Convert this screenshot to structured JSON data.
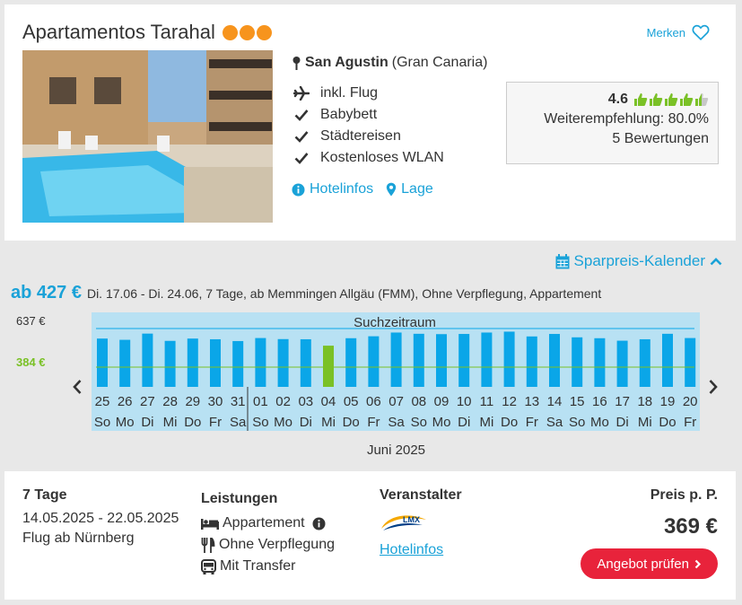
{
  "hotel": {
    "name": "Apartamentos Tarahal",
    "stars": 3,
    "star_color": "#f7941d",
    "merken_label": "Merken",
    "location_city": "San Agustin",
    "location_region": "(Gran Canaria)",
    "features": [
      {
        "icon": "plane-icon",
        "label": "inkl. Flug"
      },
      {
        "icon": "check-icon",
        "label": "Babybett"
      },
      {
        "icon": "check-icon",
        "label": "Städtereisen"
      },
      {
        "icon": "check-icon",
        "label": "Kostenloses WLAN"
      }
    ],
    "links": {
      "hotelinfos": "Hotelinfos",
      "lage": "Lage"
    },
    "rating": {
      "score": "4.6",
      "thumbs_filled": 4.5,
      "thumbs_total": 5,
      "recommendation": "Weiterempfehlung: 80.0%",
      "reviews": "5 Bewertungen"
    }
  },
  "calendar": {
    "toggle_label": "Sparpreis-Kalender",
    "summary_price": "ab 427 €",
    "summary_text": "Di. 17.06 - Di. 24.06, 7 Tage, ab Memmingen Allgäu (FMM), Ohne Verpflegung, Appartement",
    "search_label": "Suchzeitraum",
    "month_label": "Juni 2025",
    "colors": {
      "bar": "#0aa6e8",
      "selected": "#7ac126",
      "band": "#b8e1f3",
      "accent": "#1aa2d8"
    }
  },
  "chart_data": {
    "type": "bar",
    "ylim": [
      384,
      637
    ],
    "y_ticks": [
      "637 €",
      "384 €"
    ],
    "categories": [
      "25",
      "26",
      "27",
      "28",
      "29",
      "30",
      "31",
      "01",
      "02",
      "03",
      "04",
      "05",
      "06",
      "07",
      "08",
      "09",
      "10",
      "11",
      "12",
      "13",
      "14",
      "15",
      "16",
      "17",
      "18",
      "19",
      "20"
    ],
    "weekdays": [
      "So",
      "Mo",
      "Di",
      "Mi",
      "Do",
      "Fr",
      "Sa",
      "So",
      "Mo",
      "Di",
      "Mi",
      "Do",
      "Fr",
      "Sa",
      "So",
      "Mo",
      "Di",
      "Mi",
      "Do",
      "Fr",
      "Sa",
      "So",
      "Mo",
      "Di",
      "Mi",
      "Do",
      "Fr"
    ],
    "values": [
      545,
      538,
      573,
      532,
      545,
      541,
      531,
      548,
      542,
      541,
      505,
      547,
      558,
      579,
      572,
      570,
      571,
      579,
      584,
      557,
      571,
      552,
      547,
      533,
      541,
      572,
      548
    ],
    "selected_index": 10
  },
  "offer": {
    "duration": "7 Tage",
    "dates": "14.05.2025 - 22.05.2025",
    "flight": "Flug ab Nürnberg",
    "leistungen_title": "Leistungen",
    "leistungen": [
      "Appartement",
      "Ohne Verpflegung",
      "Mit Transfer"
    ],
    "veranstalter_title": "Veranstalter",
    "veranstalter_logo": "LMX Touristik",
    "hotelinfos_link": "Hotelinfos",
    "price_title": "Preis p. P.",
    "price": "369 €",
    "cta": "Angebot prüfen"
  }
}
